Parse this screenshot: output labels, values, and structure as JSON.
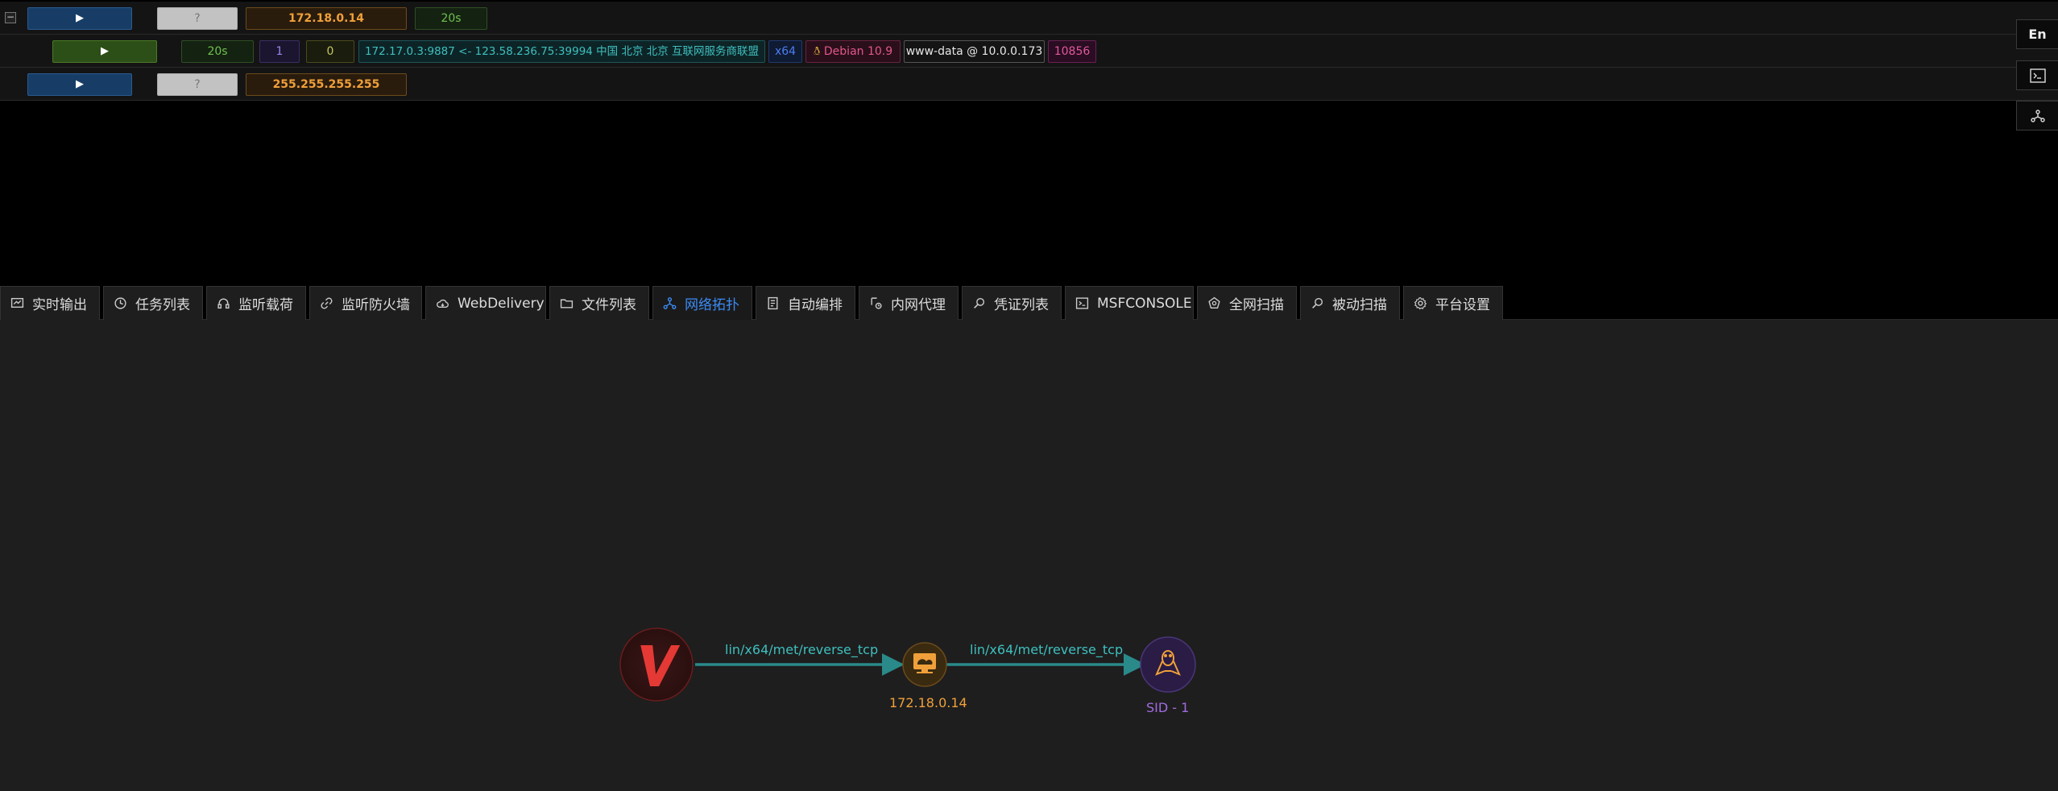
{
  "sessions": {
    "rows": [
      {
        "ip": "172.18.0.14",
        "unknown": "?",
        "time": "20s"
      },
      {
        "time": "20s",
        "count_a": "1",
        "count_b": "0",
        "connection": "172.17.0.3:9887 <- 123.58.236.75:39994 中国 北京 北京 互联网服务商联盟",
        "arch": "x64",
        "os": "Debian 10.9",
        "user": "www-data @ 10.0.0.173",
        "pid": "10856"
      },
      {
        "ip": "255.255.255.255",
        "unknown": "?"
      }
    ],
    "expand_symbol": "−",
    "play_symbol": "▶"
  },
  "side_buttons": {
    "language": "En"
  },
  "tabs": [
    {
      "label": "实时输出",
      "icon": "monitor-icon"
    },
    {
      "label": "任务列表",
      "icon": "clock-icon"
    },
    {
      "label": "监听载荷",
      "icon": "headphones-icon"
    },
    {
      "label": "监听防火墙",
      "icon": "link-icon"
    },
    {
      "label": "WebDelivery",
      "icon": "cloud-icon"
    },
    {
      "label": "文件列表",
      "icon": "folder-icon"
    },
    {
      "label": "网络拓扑",
      "icon": "network-icon",
      "active": true
    },
    {
      "label": "自动编排",
      "icon": "document-icon"
    },
    {
      "label": "内网代理",
      "icon": "proxy-icon"
    },
    {
      "label": "凭证列表",
      "icon": "search-icon"
    },
    {
      "label": "MSFCONSOLE",
      "icon": "terminal-icon"
    },
    {
      "label": "全网扫描",
      "icon": "radar-icon"
    },
    {
      "label": "被动扫描",
      "icon": "search-icon"
    },
    {
      "label": "平台设置",
      "icon": "gear-icon"
    }
  ],
  "topology": {
    "nodes": [
      {
        "id": "viper",
        "label": "V"
      },
      {
        "id": "host",
        "label": "172.18.0.14"
      },
      {
        "id": "session",
        "label": "SID - 1"
      }
    ],
    "edges": [
      {
        "from": "viper",
        "to": "host",
        "label": "lin/x64/met/reverse_tcp"
      },
      {
        "from": "host",
        "to": "session",
        "label": "lin/x64/met/reverse_tcp"
      }
    ],
    "colors": {
      "edge": "#2a8a8a",
      "edge_label": "#3fbfbf",
      "host_label": "#f0a03a",
      "session_label": "#a06be0",
      "viper_red": "#e53935"
    }
  }
}
